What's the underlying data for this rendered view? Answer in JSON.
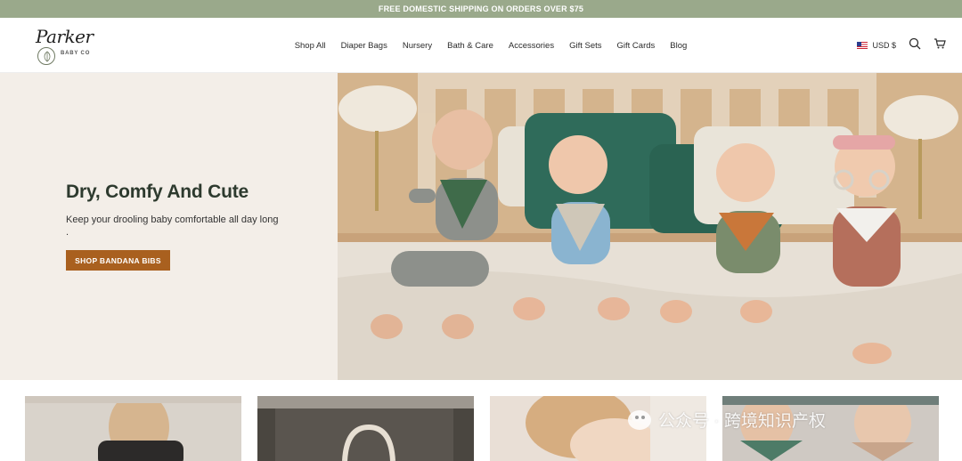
{
  "announcement": "FREE DOMESTIC SHIPPING ON ORDERS OVER $75",
  "brand": {
    "script": "Parker",
    "sub": "BABY CO"
  },
  "nav": [
    "Shop All",
    "Diaper Bags",
    "Nursery",
    "Bath & Care",
    "Accessories",
    "Gift Sets",
    "Gift Cards",
    "Blog"
  ],
  "utility": {
    "currency": "USD $",
    "icons": [
      "us-flag-icon",
      "search-icon",
      "cart-icon"
    ]
  },
  "hero": {
    "title": "Dry, Comfy And Cute",
    "subtitle": "Keep your drooling baby comfortable all day long .",
    "cta": "SHOP BANDANA BIBS",
    "image": "four-babies-on-bed-photo"
  },
  "cards": [
    "backpack-photo",
    "bag-handle-photo",
    "mother-baby-photo",
    "babies-bibs-photo"
  ],
  "watermark": "公众号 · 跨境知识产权",
  "colors": {
    "announce": "#9aa98b",
    "cta": "#a9601f",
    "hero_bg": "#f3eee8"
  }
}
